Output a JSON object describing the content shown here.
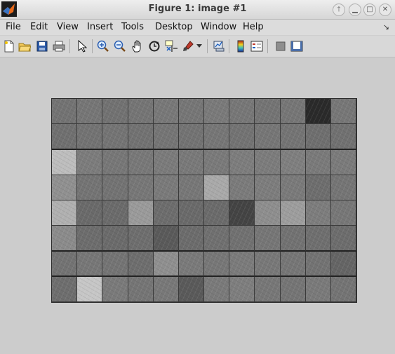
{
  "window": {
    "title": "Figure 1: image #1",
    "buttons": {
      "up": "🡑",
      "minimize": "▁",
      "maximize": "□",
      "close": "✕"
    }
  },
  "menu": {
    "items": [
      {
        "label": "File"
      },
      {
        "label": "Edit"
      },
      {
        "label": "View"
      },
      {
        "label": "Insert"
      },
      {
        "label": "Tools"
      },
      {
        "label": "Desktop"
      },
      {
        "label": "Window"
      },
      {
        "label": "Help"
      }
    ],
    "dock_glyph": "↘"
  },
  "toolbar": {
    "tools": [
      {
        "name": "new-figure-icon"
      },
      {
        "name": "open-file-icon"
      },
      {
        "name": "save-icon"
      },
      {
        "name": "print-icon"
      },
      {
        "name": "select-arrow-icon"
      },
      {
        "name": "zoom-in-icon"
      },
      {
        "name": "zoom-out-icon"
      },
      {
        "name": "pan-hand-icon"
      },
      {
        "name": "rotate-3d-icon"
      },
      {
        "name": "data-cursor-icon"
      },
      {
        "name": "brush-icon"
      },
      {
        "name": "link-plot-icon"
      },
      {
        "name": "colorbar-icon"
      },
      {
        "name": "legend-icon"
      },
      {
        "name": "hide-plot-tools-icon"
      },
      {
        "name": "show-plot-tools-icon"
      }
    ]
  },
  "montage": {
    "rows": 8,
    "cols": 12,
    "tile_shades": [
      "#737373",
      "#767676",
      "#727272",
      "#757575",
      "#787878",
      "#767676",
      "#7a7a7a",
      "#777777",
      "#747474",
      "#767676",
      "#2a2a2a",
      "#777777",
      "#707070",
      "#737373",
      "#747474",
      "#727272",
      "#757575",
      "#737373",
      "#767676",
      "#737373",
      "#767676",
      "#747474",
      "#6f6f6f",
      "#717171",
      "#bdbdbd",
      "#7c7c7c",
      "#777777",
      "#787878",
      "#7b7b7b",
      "#797979",
      "#7a7a7a",
      "#7d7d7d",
      "#7c7c7c",
      "#7f7f7f",
      "#7a7a7a",
      "#7b7b7b",
      "#909090",
      "#747474",
      "#737373",
      "#777777",
      "#7a7a7a",
      "#777777",
      "#a9a9a9",
      "#7b7b7b",
      "#7d7d7d",
      "#7a7a7a",
      "#6e6e6e",
      "#757575",
      "#b0b0b0",
      "#6a6a6a",
      "#6b6b6b",
      "#9a9a9a",
      "#6d6d6d",
      "#6a6a6a",
      "#6b6b6b",
      "#444444",
      "#8e8e8e",
      "#9d9d9d",
      "#7d7d7d",
      "#777777",
      "#8b8b8b",
      "#6d6d6d",
      "#6b6b6b",
      "#6e6e6e",
      "#5a5a5a",
      "#6c6c6c",
      "#707070",
      "#717171",
      "#767676",
      "#727272",
      "#6f6f6f",
      "#6d6d6d",
      "#737373",
      "#777777",
      "#747474",
      "#6e6e6e",
      "#8f8f8f",
      "#7a7a7a",
      "#777777",
      "#7b7b7b",
      "#787878",
      "#767676",
      "#737373",
      "#656565",
      "#6e6e6e",
      "#c6c6c6",
      "#7a7a7a",
      "#757575",
      "#787878",
      "#5a5a5a",
      "#7a7a7a",
      "#7e7e7e",
      "#777777",
      "#757575",
      "#7a7a7a",
      "#747474"
    ]
  }
}
